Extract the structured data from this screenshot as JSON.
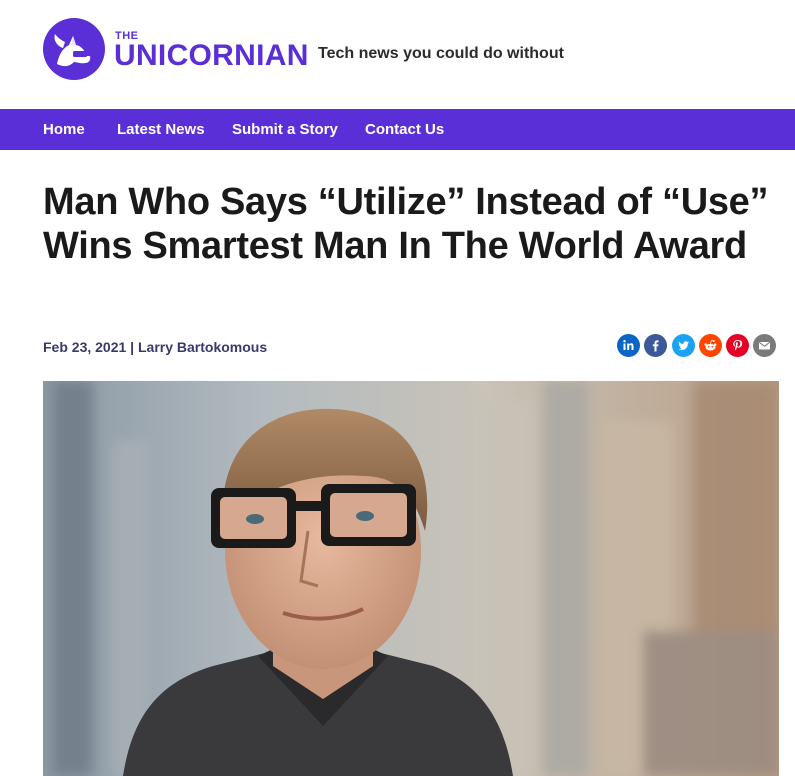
{
  "brand": {
    "small": "THE",
    "big": "UNICORNIAN",
    "tagline": "Tech news you could do without",
    "color": "#5a2fd6",
    "icon": "unicorn-icon"
  },
  "nav": {
    "background": "#5b2fd8",
    "items": [
      "Home",
      "Latest News",
      "Submit a Story",
      "Contact Us"
    ]
  },
  "article": {
    "headline": "Man Who Says “Utilize” Instead of “Use” Wins Smartest Man In The World Award",
    "date": "Feb 23, 2021",
    "separator": "|",
    "author": "Larry Bartokomous"
  },
  "share": [
    {
      "icon": "linkedin-icon",
      "color": "#0a66c2"
    },
    {
      "icon": "facebook-icon",
      "color": "#3b5998"
    },
    {
      "icon": "twitter-icon",
      "color": "#1da1f2"
    },
    {
      "icon": "reddit-icon",
      "color": "#ff4500"
    },
    {
      "icon": "pinterest-icon",
      "color": "#e60023"
    },
    {
      "icon": "email-icon",
      "color": "#7a7a7a"
    }
  ]
}
